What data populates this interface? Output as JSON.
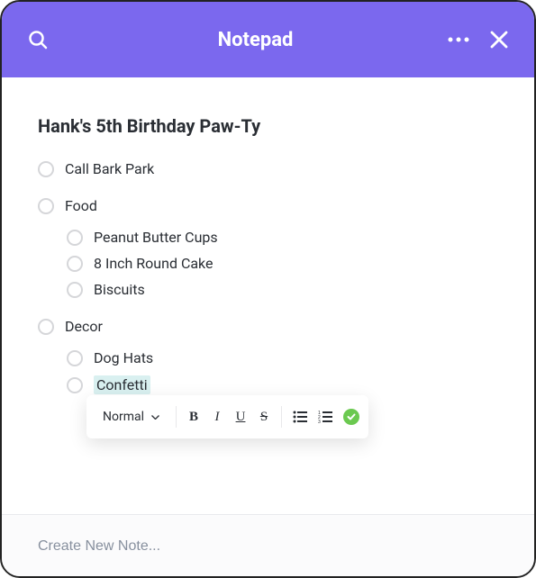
{
  "header": {
    "title": "Notepad"
  },
  "note": {
    "title": "Hank's 5th Birthday Paw-Ty",
    "items": [
      {
        "label": "Call Bark Park"
      },
      {
        "label": "Food",
        "children": [
          {
            "label": "Peanut Butter Cups"
          },
          {
            "label": "8 Inch Round Cake"
          },
          {
            "label": "Biscuits"
          }
        ]
      },
      {
        "label": "Decor",
        "children": [
          {
            "label": "Dog Hats"
          },
          {
            "label": "Confetti",
            "highlighted": true
          }
        ]
      }
    ]
  },
  "toolbar": {
    "style_label": "Normal",
    "bold": "B",
    "italic": "I",
    "underline": "U",
    "strike": "S"
  },
  "footer": {
    "placeholder": "Create New Note..."
  }
}
